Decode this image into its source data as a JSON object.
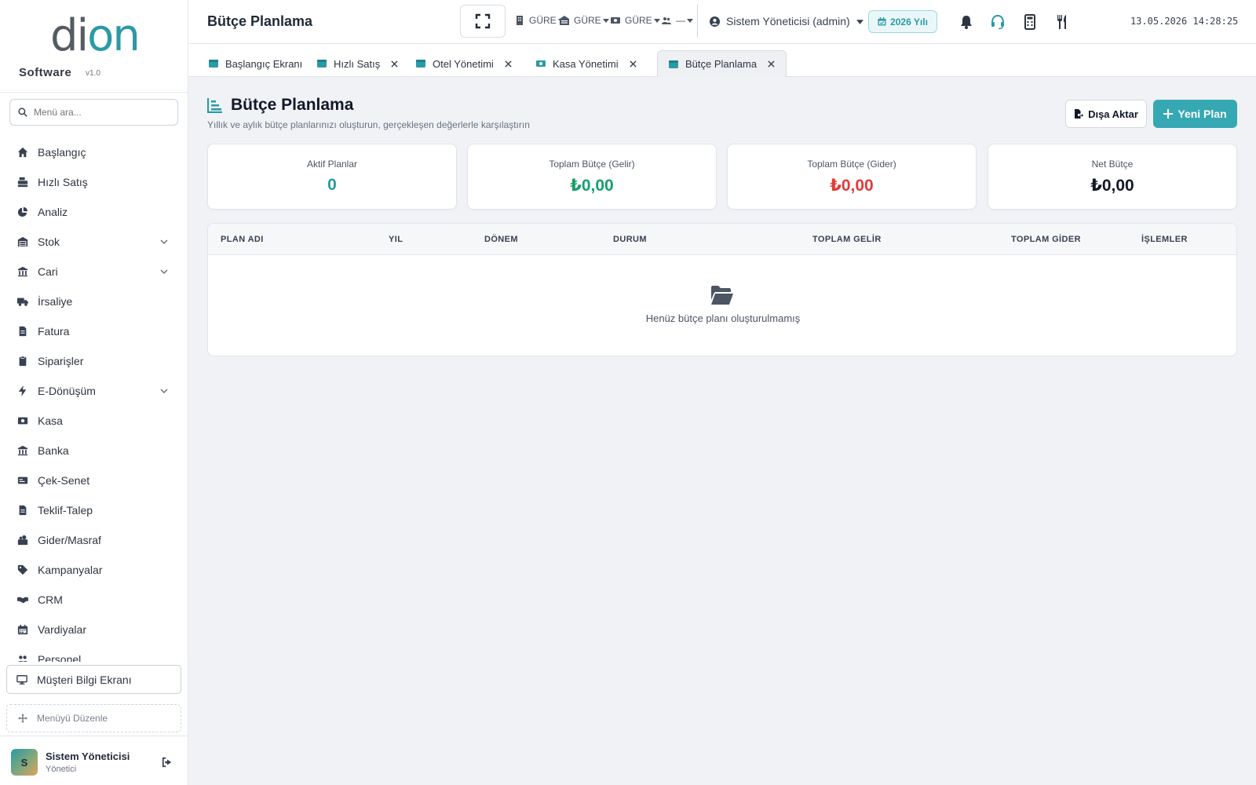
{
  "brand": {
    "logo_part1": "di",
    "logo_part2": "on",
    "name": "Software",
    "version": "v1.0"
  },
  "sidebar": {
    "search_placeholder": "Menü ara...",
    "items": [
      {
        "label": "Başlangıç",
        "icon": "home-icon"
      },
      {
        "label": "Hızlı Satış",
        "icon": "cash-register-icon"
      },
      {
        "label": "Analiz",
        "icon": "pie-chart-icon"
      },
      {
        "label": "Stok",
        "icon": "warehouse-icon",
        "expandable": true
      },
      {
        "label": "Cari",
        "icon": "bank-icon",
        "expandable": true
      },
      {
        "label": "İrsaliye",
        "icon": "truck-icon"
      },
      {
        "label": "Fatura",
        "icon": "invoice-icon"
      },
      {
        "label": "Siparişler",
        "icon": "clipboard-icon"
      },
      {
        "label": "E-Dönüşüm",
        "icon": "bolt-icon",
        "expandable": true
      },
      {
        "label": "Kasa",
        "icon": "cash-icon"
      },
      {
        "label": "Banka",
        "icon": "bank-icon"
      },
      {
        "label": "Çek-Senet",
        "icon": "cheque-icon"
      },
      {
        "label": "Teklif-Talep",
        "icon": "document-icon"
      },
      {
        "label": "Gider/Masraf",
        "icon": "expense-icon"
      },
      {
        "label": "Kampanyalar",
        "icon": "tags-icon"
      },
      {
        "label": "CRM",
        "icon": "handshake-icon"
      },
      {
        "label": "Vardiyalar",
        "icon": "calendar-icon"
      },
      {
        "label": "Personel",
        "icon": "users-icon"
      }
    ],
    "customer_screen": "Müşteri Bilgi Ekranı",
    "edit_menu": "Menüyü Düzenle",
    "user": {
      "initial": "S",
      "name": "Sistem Yöneticisi",
      "role": "Yönetici"
    }
  },
  "topbar": {
    "title": "Bütçe Planlama",
    "selectors": [
      "GÜRE",
      "GÜRE",
      "GÜRE",
      "—"
    ],
    "user_select": "Sistem Yöneticisi (admin)",
    "year": "2026 Yılı",
    "datetime": "13.05.2026 14:28:25"
  },
  "tabs": [
    {
      "label": "Başlangıç Ekranı",
      "closable": false
    },
    {
      "label": "Hızlı Satış",
      "closable": true
    },
    {
      "label": "Otel Yönetimi",
      "closable": true
    },
    {
      "label": "Kasa Yönetimi",
      "closable": true
    },
    {
      "label": "Bütçe Planlama",
      "closable": true,
      "active": true
    }
  ],
  "page": {
    "title": "Bütçe Planlama",
    "subtitle": "Yıllık ve aylık bütçe planlarınızı oluşturun, gerçekleşen değerlerle karşılaştırın",
    "export_label": "Dışa Aktar",
    "new_label": "Yeni Plan"
  },
  "stats": [
    {
      "label": "Aktif Planlar",
      "value": "0",
      "color": "#2a9aa6"
    },
    {
      "label": "Toplam Bütçe (Gelir)",
      "value": "₺0,00",
      "color": "#16a06a"
    },
    {
      "label": "Toplam Bütçe (Gider)",
      "value": "₺0,00",
      "color": "#e03b3b"
    },
    {
      "label": "Net Bütçe",
      "value": "₺0,00",
      "color": "#111827"
    }
  ],
  "table": {
    "columns": [
      "PLAN ADI",
      "YIL",
      "DÖNEM",
      "DURUM",
      "TOPLAM GELİR",
      "TOPLAM GİDER",
      "İŞLEMLER"
    ],
    "empty_text": "Henüz bütçe planı oluşturulmamış"
  },
  "colors": {
    "accent": "#36a8b3",
    "income": "#16a06a",
    "expense": "#e03b3b"
  }
}
